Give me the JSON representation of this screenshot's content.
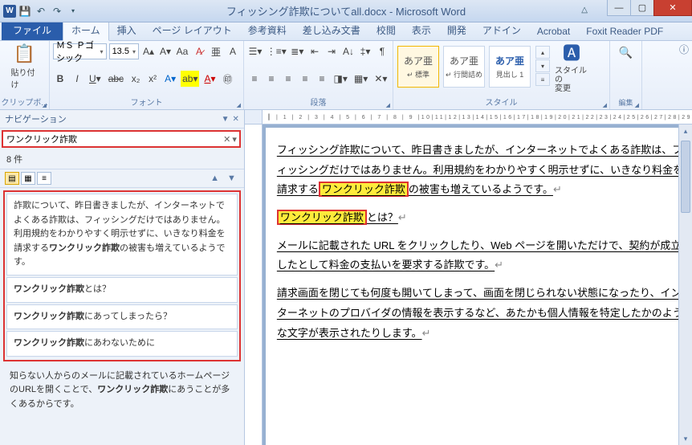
{
  "titlebar": {
    "title": "フィッシング詐欺についてall.docx - Microsoft Word"
  },
  "tabs": {
    "file": "ファイル",
    "home": "ホーム",
    "insert": "挿入",
    "layout": "ページ レイアウト",
    "references": "参考資料",
    "mailings": "差し込み文書",
    "review": "校閲",
    "view": "表示",
    "developer": "開発",
    "addins": "アドイン",
    "acrobat": "Acrobat",
    "foxit": "Foxit Reader PDF"
  },
  "ribbon": {
    "clipboard": {
      "label": "クリップボ...",
      "paste": "貼り付け"
    },
    "font": {
      "label": "フォント",
      "name": "ＭＳ Ｐゴシック",
      "size": "13.5"
    },
    "paragraph": {
      "label": "段落"
    },
    "styles": {
      "label": "スタイル",
      "s1": {
        "preview": "あア亜",
        "name": "↵ 標準"
      },
      "s2": {
        "preview": "あア亜",
        "name": "↵ 行間詰め"
      },
      "s3": {
        "preview": "あア亜",
        "name": "見出し 1"
      },
      "change": "スタイルの\n変更"
    },
    "editing": {
      "label": "編集"
    }
  },
  "nav": {
    "title": "ナビゲーション",
    "search_value": "ワンクリック詐欺",
    "count": "8 件",
    "r1": "詐欺について、昨日書きましたが、インターネットでよくある詐欺は、フィッシングだけではありません。利用規約をわかりやすく明示せずに、いきなり料金を請求するワンクリック詐欺の被害も増えているようです。",
    "r2": "ワンクリック詐欺とは？",
    "r3": "ワンクリック詐欺にあってしまったら？",
    "r4": "ワンクリック詐欺にあわないために",
    "extra": "知らない人からのメールに記載されているホームページのURLを開くことで、ワンクリック詐欺にあうことが多くあるからです。"
  },
  "doc": {
    "p1a": "フィッシング詐欺について、昨日書きましたが、インターネットでよくある詐欺は、フィッシングだけではありません。利用規約をわかりやすく明示せずに、いきなり料金を請求する",
    "p1b": "ワンクリック詐欺",
    "p1c": "の被害も増えているようです。",
    "p2a": "ワンクリック詐欺",
    "p2b": "とは？",
    "p3": "メールに記載された URL をクリックしたり、Web ページを開いただけで、契約が成立したとして料金の支払いを要求する詐欺です。",
    "p4": "請求画面を閉じても何度も開いてしまって、画面を閉じられない状態になったり、インターネットのプロバイダの情報を表示するなど、あたかも個人情報を特定したかのような文字が表示されたりします。"
  },
  "ruler": "┃ | 1 | 2 | 3 | 4 | 5 | 6 | 7 | 8 | 9 |10|11|12|13|14|15|16|17|18|19|20|21|22|23|24|25|26|27|28|29"
}
